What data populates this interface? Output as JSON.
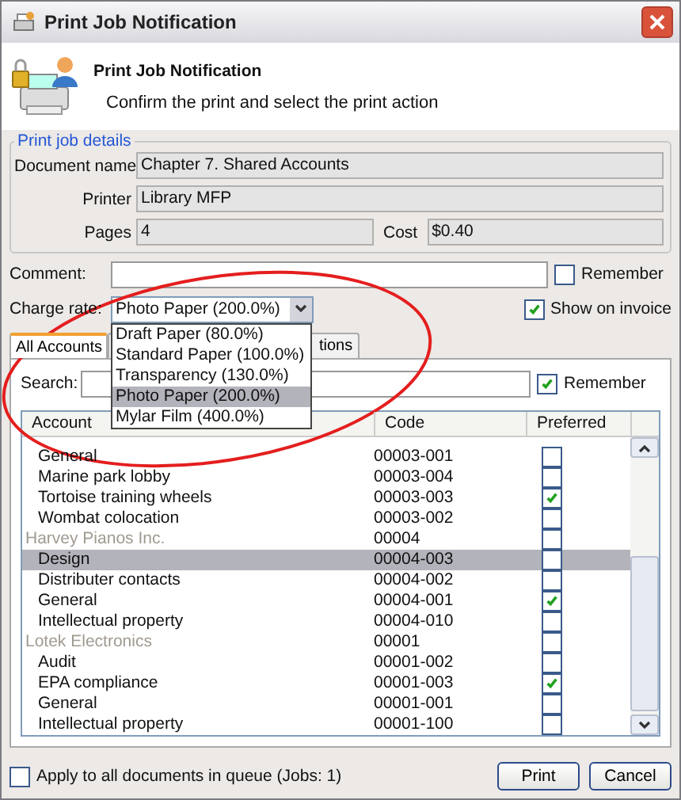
{
  "window": {
    "title": "Print Job Notification"
  },
  "header": {
    "title": "Print Job Notification",
    "subtitle": "Confirm the print and select the print action"
  },
  "details": {
    "legend": "Print job details",
    "fields": [
      {
        "label": "Document name",
        "value": "Chapter 7. Shared Accounts"
      },
      {
        "label": "Printer",
        "value": "Library MFP"
      }
    ],
    "pages": {
      "label": "Pages",
      "value": "4"
    },
    "cost": {
      "label": "Cost",
      "value": "$0.40"
    }
  },
  "comment": {
    "label": "Comment:",
    "remember": {
      "label": "Remember",
      "checked": false
    }
  },
  "charge_rate": {
    "label": "Charge rate:",
    "value": "Photo Paper (200.0%)",
    "show_on_invoice": {
      "label": "Show on invoice",
      "checked": true
    },
    "options": [
      {
        "label": "Draft Paper (80.0%)",
        "selected": false
      },
      {
        "label": "Standard Paper (100.0%)",
        "selected": false
      },
      {
        "label": "Transparency (130.0%)",
        "selected": false
      },
      {
        "label": "Photo Paper (200.0%)",
        "selected": true
      },
      {
        "label": "Mylar Film (400.0%)",
        "selected": false
      }
    ]
  },
  "tabs": [
    {
      "label": "All Accounts",
      "selected": true
    },
    {
      "label": "tions",
      "selected": false
    }
  ],
  "search": {
    "label": "Search:",
    "remember": {
      "label": "Remember",
      "checked": true
    }
  },
  "table": {
    "columns": [
      "Account",
      "Code",
      "Preferred"
    ],
    "rows": [
      {
        "kind": "account",
        "account": "General",
        "code": "00003-001",
        "preferred": false,
        "selected": false
      },
      {
        "kind": "account",
        "account": "Marine park lobby",
        "code": "00003-004",
        "preferred": false,
        "selected": false
      },
      {
        "kind": "account",
        "account": "Tortoise training wheels",
        "code": "00003-003",
        "preferred": true,
        "selected": false
      },
      {
        "kind": "account",
        "account": "Wombat colocation",
        "code": "00003-002",
        "preferred": false,
        "selected": false
      },
      {
        "kind": "group",
        "account": "Harvey Pianos Inc.",
        "code": "00004",
        "preferred": false,
        "selected": false
      },
      {
        "kind": "account",
        "account": "Design",
        "code": "00004-003",
        "preferred": false,
        "selected": true
      },
      {
        "kind": "account",
        "account": "Distributer contacts",
        "code": "00004-002",
        "preferred": false,
        "selected": false
      },
      {
        "kind": "account",
        "account": "General",
        "code": "00004-001",
        "preferred": true,
        "selected": false
      },
      {
        "kind": "account",
        "account": "Intellectual property",
        "code": "00004-010",
        "preferred": false,
        "selected": false
      },
      {
        "kind": "group",
        "account": "Lotek Electronics",
        "code": "00001",
        "preferred": false,
        "selected": false
      },
      {
        "kind": "account",
        "account": "Audit",
        "code": "00001-002",
        "preferred": false,
        "selected": false
      },
      {
        "kind": "account",
        "account": "EPA compliance",
        "code": "00001-003",
        "preferred": true,
        "selected": false
      },
      {
        "kind": "account",
        "account": "General",
        "code": "00001-001",
        "preferred": false,
        "selected": false
      },
      {
        "kind": "account",
        "account": "Intellectual property",
        "code": "00001-100",
        "preferred": false,
        "selected": false
      }
    ]
  },
  "apply_all": {
    "label": "Apply to all documents in queue (Jobs: 1)",
    "checked": false
  },
  "buttons": [
    "Print",
    "Cancel"
  ]
}
